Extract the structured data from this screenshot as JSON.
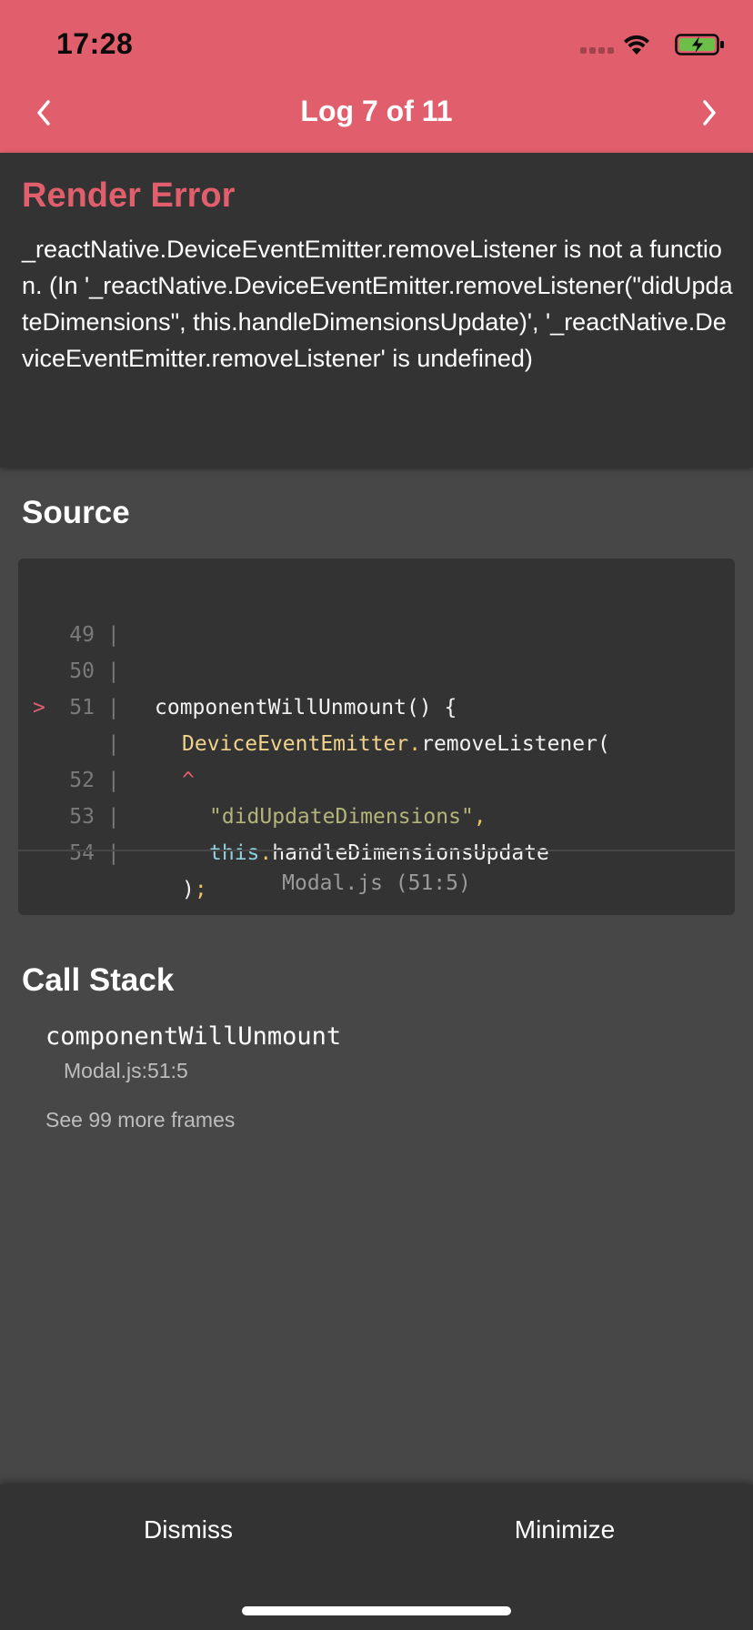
{
  "status_bar": {
    "time": "17:28"
  },
  "header": {
    "title": "Log 7 of 11",
    "prev_icon": "chevron-left-icon",
    "next_icon": "chevron-right-icon",
    "background_color": "#e15f6c"
  },
  "error": {
    "title": "Render Error",
    "message": "_reactNative.DeviceEventEmitter.removeListener is not a function. (In '_reactNative.DeviceEventEmitter.removeListener(\"didUpdateDimensions\", this.handleDimensionsUpdate)', '_reactNative.DeviceEventEmitter.removeListener' is undefined)"
  },
  "source": {
    "title": "Source",
    "lines": [
      {
        "num": "49",
        "marker": "",
        "parts": []
      },
      {
        "num": "50",
        "marker": "",
        "parts": [
          "componentWillUnmount() {"
        ]
      },
      {
        "num": "51",
        "marker": ">",
        "parts": [
          "DeviceEventEmitter",
          ".",
          "removeListener("
        ]
      },
      {
        "num": "",
        "marker": "",
        "parts": [
          "^"
        ]
      },
      {
        "num": "52",
        "marker": "",
        "parts": [
          "\"didUpdateDimensions\"",
          ","
        ]
      },
      {
        "num": "53",
        "marker": "",
        "parts": [
          "this",
          ".",
          "handleDimensionsUpdate"
        ]
      },
      {
        "num": "54",
        "marker": "",
        "parts": [
          ")",
          ";"
        ]
      }
    ],
    "file_location": "Modal.js (51:5)"
  },
  "call_stack": {
    "title": "Call Stack",
    "frames": [
      {
        "name": "componentWillUnmount",
        "location": "Modal.js:51:5"
      }
    ],
    "more_frames": "See 99 more frames"
  },
  "footer": {
    "dismiss_label": "Dismiss",
    "minimize_label": "Minimize"
  }
}
